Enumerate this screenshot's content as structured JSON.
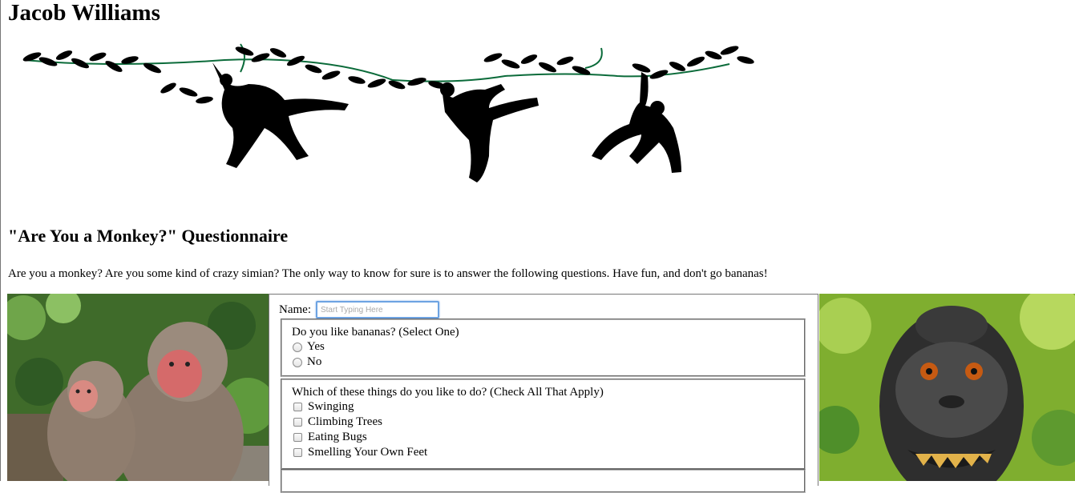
{
  "header": {
    "author_name": "Jacob Williams"
  },
  "banner": {
    "icon": "hanging-monkeys-vine-banner"
  },
  "questionnaire": {
    "title": "\"Are You a Monkey?\" Questionnaire",
    "intro": "Are you a monkey? Are you some kind of crazy simian? The only way to know for sure is to answer the following questions. Have fun, and don't go bananas!"
  },
  "form": {
    "name_label": "Name:",
    "name_placeholder": "Start Typing Here",
    "name_value": "",
    "q1": {
      "prompt": "Do you like bananas? (Select One)",
      "options": [
        "Yes",
        "No"
      ]
    },
    "q2": {
      "prompt": "Which of these things do you like to do? (Check All That Apply)",
      "options": [
        "Swinging",
        "Climbing Trees",
        "Eating Bugs",
        "Smelling Your Own Feet"
      ]
    },
    "q3": {
      "prompt": ""
    }
  },
  "images": {
    "left": "two-macaque-monkeys-photo",
    "right": "grinning-black-macaque-photo"
  },
  "colors": {
    "vine_green": "#0b6b3a",
    "input_focus": "#6da3e2",
    "foliage_green": "#4f8f2a"
  }
}
